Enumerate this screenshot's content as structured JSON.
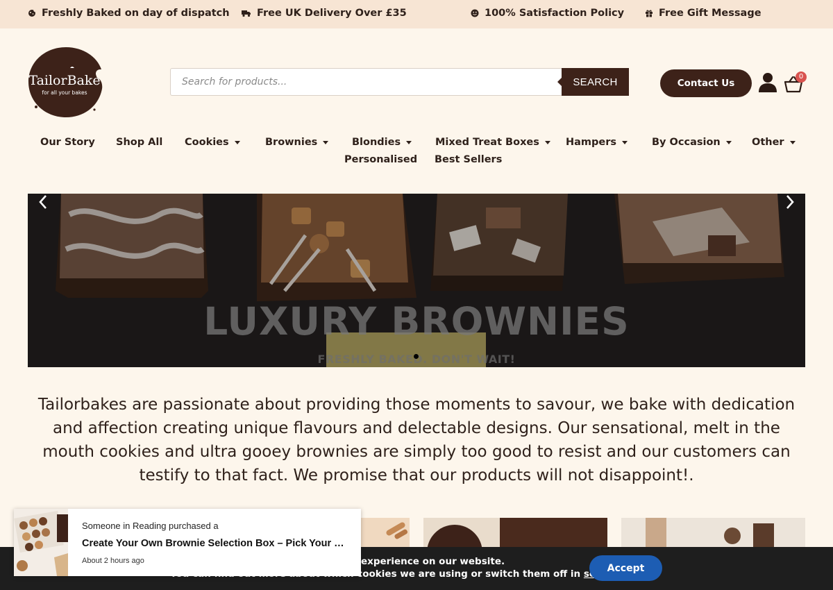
{
  "topbar": {
    "items": [
      {
        "label": "Freshly Baked on day of dispatch",
        "icon": "cookie-icon"
      },
      {
        "label": "Free UK Delivery Over £35",
        "icon": "truck-icon"
      },
      {
        "label": "100% Satisfaction Policy",
        "icon": "smile-icon"
      },
      {
        "label": "Free Gift Message",
        "icon": "gift-icon"
      }
    ]
  },
  "header": {
    "logo_text": "TailorBake",
    "logo_tagline": "for all your bakes",
    "search_placeholder": "Search for products...",
    "search_button": "SEARCH",
    "contact_button": "Contact Us",
    "cart_count": "0"
  },
  "nav": {
    "items": [
      {
        "label": "Our Story",
        "dropdown": false
      },
      {
        "label": "Shop All",
        "dropdown": false
      },
      {
        "label": "Cookies",
        "dropdown": true
      },
      {
        "label": "Brownies",
        "dropdown": true
      },
      {
        "label": "Blondies",
        "dropdown": true
      },
      {
        "label": "Mixed Treat Boxes",
        "dropdown": true
      },
      {
        "label": "Hampers",
        "dropdown": true
      },
      {
        "label": "By Occasion",
        "dropdown": true
      },
      {
        "label": "Other",
        "dropdown": true
      },
      {
        "label": "Personalised",
        "dropdown": false
      },
      {
        "label": "Best Sellers",
        "dropdown": false
      }
    ]
  },
  "hero": {
    "title": "LUXURY BROWNIES",
    "subtitle": "FRESHLY BAKED. DON'T WAIT!"
  },
  "about": {
    "text": "Tailorbakes are passionate about providing those moments to savour, we bake with dedication and affection creating unique flavours and delectable designs. Our sensational, melt in the mouth cookies and ultra gooey brownies are simply too good to resist and our customers can testify to that fact. We promise that our products will not disappoint!."
  },
  "cookie_notice": {
    "line1": "experience on our website.",
    "line2_prefix": "You can find out more about which cookies we are using or switch them off in ",
    "line2_link": "settings",
    "line2_suffix": ".",
    "accept_button": "Accept"
  },
  "purchase_popup": {
    "line1": "Someone in Reading purchased a",
    "product": "Create Your Own Brownie Selection Box – Pick Your …",
    "time": "About 2 hours ago"
  },
  "colors": {
    "brand_brown": "#3d2219",
    "topbar_bg": "#f7e5d4",
    "page_bg": "#fdf6ec",
    "accept_blue": "#1d5db3",
    "badge_red": "#d9534f"
  }
}
